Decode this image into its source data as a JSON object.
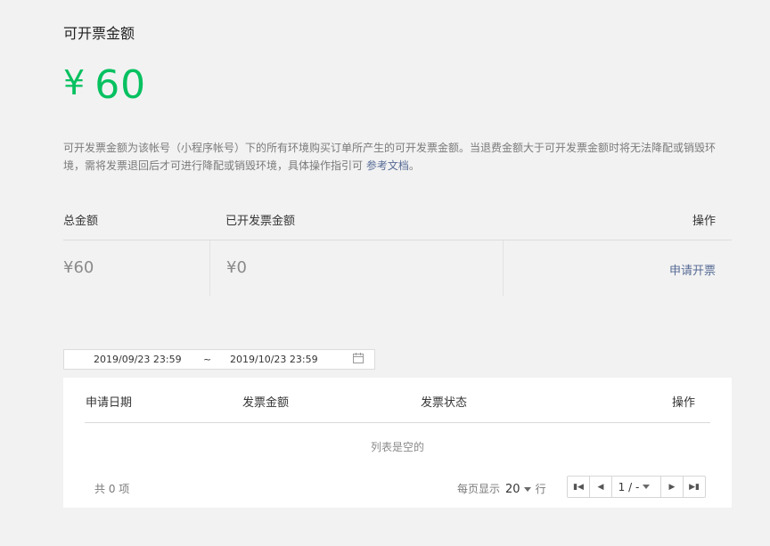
{
  "title": "可开票金额",
  "amount": {
    "currency": "¥",
    "value": "60"
  },
  "description": {
    "text": "可开发票金额为该帐号（小程序帐号）下的所有环境购买订单所产生的可开发票金额。当退费金额大于可开发票金额时将无法降配或销毁环境，需将发票退回后才可进行降配或销毁环境，具体操作指引可 ",
    "link": "参考文档",
    "end": "。"
  },
  "summary": {
    "headers": {
      "total": "总金额",
      "invoiced": "已开发票金额",
      "action": "操作"
    },
    "values": {
      "total": "¥60",
      "invoiced": "¥0"
    },
    "apply_label": "申请开票"
  },
  "date_range": {
    "start": "2019/09/23 23:59",
    "separator": "~",
    "end": "2019/10/23 23:59",
    "icon": "calendar-icon"
  },
  "list": {
    "headers": {
      "date": "申请日期",
      "amount": "发票金额",
      "status": "发票状态",
      "action": "操作"
    },
    "empty_text": "列表是空的",
    "total_text": "共 0 项",
    "per_page_label": "每页显示",
    "per_page_value": "20",
    "rows_label": "行",
    "page_indicator": "1 / -"
  },
  "colors": {
    "accent_green": "#07c160",
    "link": "#576b95",
    "background": "#f2f2f2"
  }
}
